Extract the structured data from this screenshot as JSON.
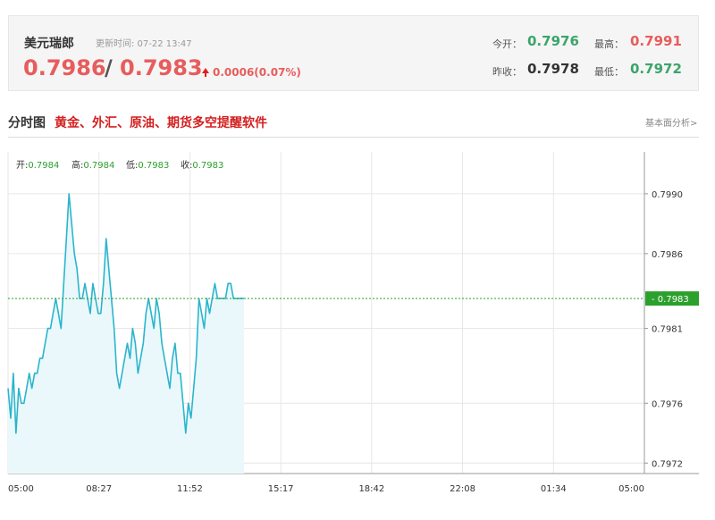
{
  "header": {
    "pair_name": "美元瑞郎",
    "update_label": "更新时间: 07-22 13:47",
    "bid": "0.7986",
    "slash": "/",
    "ask": "0.7983",
    "change": "0.0006(0.07%)",
    "open_label": "今开：",
    "open_value": "0.7976",
    "high_label": "最高：",
    "high_value": "0.7991",
    "prev_close_label": "昨收：",
    "prev_close_value": "0.7978",
    "low_label": "最低：",
    "low_value": "0.7972"
  },
  "section": {
    "title": "分时图",
    "promo_link": "黄金、外汇、原油、期货多空提醒软件",
    "analysis_link": "基本面分析>"
  },
  "ohlc": {
    "open_label": "开:",
    "open_value": "0.7984",
    "high_label": "高:",
    "high_value": "0.7984",
    "low_label": "低:",
    "low_value": "0.7983",
    "close_label": "收:",
    "close_value": "0.7983"
  },
  "chart_data": {
    "type": "area",
    "x_ticks": [
      "05:00",
      "08:27",
      "11:52",
      "15:17",
      "18:42",
      "22:08",
      "01:34",
      "05:00"
    ],
    "y_ticks": [
      "0.7990",
      "0.7986",
      "0.7981",
      "0.7976",
      "0.7972"
    ],
    "y_range": [
      0.79713,
      0.79928
    ],
    "x_range_minutes": [
      300,
      1740
    ],
    "current_price": 0.7983,
    "current_label": "0.7983",
    "series": [
      {
        "x": [
          300,
          306,
          312,
          318,
          324,
          330,
          336,
          342,
          348,
          354,
          360,
          366,
          372,
          378,
          384,
          390,
          396,
          402,
          408,
          414,
          420,
          426,
          432,
          438,
          444,
          450,
          456,
          462,
          468,
          474,
          480,
          486,
          492,
          498,
          504,
          510,
          516,
          522,
          528,
          534,
          540,
          546,
          552,
          558,
          564,
          570,
          576,
          582,
          588,
          594,
          600,
          606,
          612,
          618,
          624,
          630,
          636,
          642,
          648,
          654,
          660,
          666,
          672,
          678,
          684,
          690,
          696,
          702,
          708,
          714,
          720,
          726,
          732,
          738,
          744,
          750,
          756,
          762,
          768,
          774,
          780,
          786,
          792,
          798,
          804,
          810,
          816,
          822,
          828,
          834
        ],
        "y": [
          0.7977,
          0.7975,
          0.7978,
          0.7974,
          0.7977,
          0.7976,
          0.7976,
          0.7977,
          0.7978,
          0.7977,
          0.7978,
          0.7978,
          0.7979,
          0.7979,
          0.798,
          0.7981,
          0.7981,
          0.7982,
          0.7983,
          0.7982,
          0.7981,
          0.7984,
          0.7987,
          0.799,
          0.7988,
          0.7986,
          0.7985,
          0.7983,
          0.7983,
          0.7984,
          0.7983,
          0.7982,
          0.7984,
          0.7983,
          0.7982,
          0.7982,
          0.7984,
          0.7987,
          0.7985,
          0.7983,
          0.7981,
          0.7978,
          0.7977,
          0.7978,
          0.7979,
          0.798,
          0.7979,
          0.7981,
          0.798,
          0.7978,
          0.7979,
          0.798,
          0.7982,
          0.7983,
          0.7982,
          0.7981,
          0.7983,
          0.7982,
          0.798,
          0.7979,
          0.7978,
          0.7977,
          0.7979,
          0.798,
          0.7978,
          0.7978,
          0.7976,
          0.7974,
          0.7976,
          0.7975,
          0.7977,
          0.7979,
          0.7983,
          0.7982,
          0.7981,
          0.7983,
          0.7982,
          0.7983,
          0.7984,
          0.7983,
          0.7983,
          0.7983,
          0.7983,
          0.7984,
          0.7984,
          0.7983,
          0.7983,
          0.7983,
          0.7983,
          0.7983
        ]
      }
    ],
    "colors": {
      "line": "#2bb5cc",
      "fill": "#eaf8fb",
      "grid": "#e6e6e6",
      "current": "#2ca02c"
    }
  }
}
